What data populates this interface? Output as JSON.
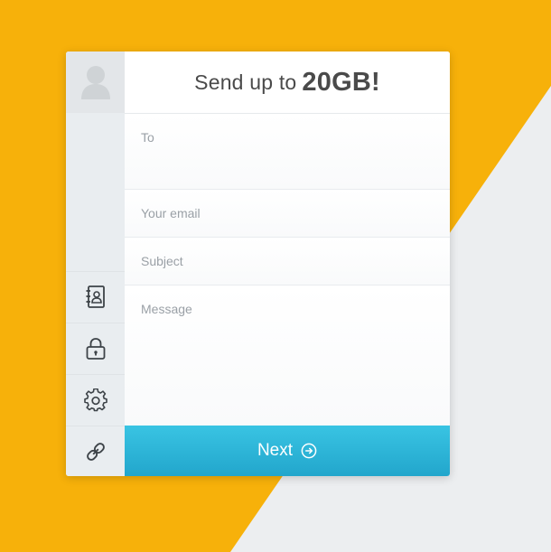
{
  "header": {
    "prefix": "Send up to",
    "highlight": "20GB!"
  },
  "form": {
    "to_placeholder": "To",
    "email_placeholder": "Your email",
    "subject_placeholder": "Subject",
    "message_placeholder": "Message"
  },
  "next_button": {
    "label": "Next",
    "icon": "circle-arrow-right-icon"
  },
  "sidebar": {
    "avatar_icon": "user-avatar-icon",
    "items": [
      {
        "icon": "address-book-icon"
      },
      {
        "icon": "lock-icon"
      },
      {
        "icon": "gear-icon"
      },
      {
        "icon": "link-icon"
      }
    ]
  },
  "colors": {
    "background_accent": "#f7b10a",
    "background_light": "#eceef0",
    "button_gradient_top": "#39c4e3",
    "button_gradient_bottom": "#22a6cc",
    "sidebar": "#e9edf0",
    "text_dark": "#4a4a4a",
    "placeholder": "#9aa0a6"
  }
}
